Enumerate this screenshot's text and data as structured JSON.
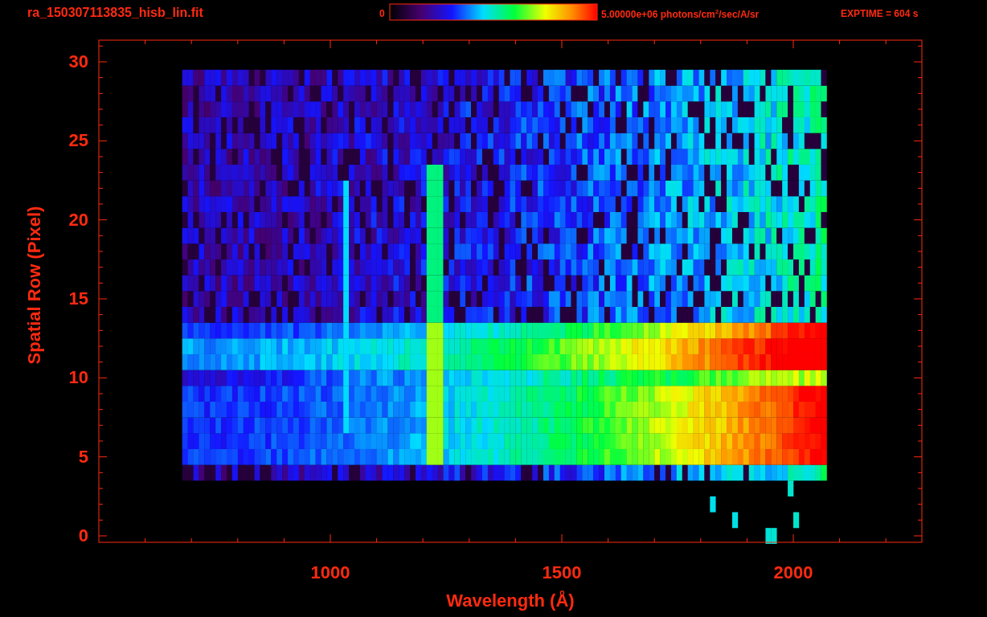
{
  "title": "ra_150307113835_hisb_lin.fit",
  "colorbar": {
    "min_label": "0",
    "max_label": "5.00000e+06 photons/cm$^{2}$/sec/A/sr"
  },
  "exposure": "EXPTIME = 604 s",
  "y_axis": {
    "title": "Spatial Row (Pixel)",
    "ticks": [
      "30",
      "25",
      "20",
      "15",
      "10",
      "5",
      "0"
    ]
  },
  "x_axis": {
    "title": "Wavelength (Å)",
    "ticks": [
      "1000",
      "1500",
      "2000"
    ]
  }
}
